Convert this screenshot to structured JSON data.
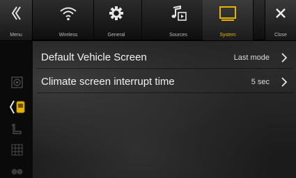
{
  "topbar": {
    "menu_label": "Menu",
    "close_label": "Close",
    "tabs": [
      {
        "label": "Wireless"
      },
      {
        "label": "General"
      },
      {
        "label": "Sources"
      },
      {
        "label": "System"
      }
    ]
  },
  "settings": [
    {
      "label": "Default Vehicle Screen",
      "value": "Last mode"
    },
    {
      "label": "Climate screen interrupt time",
      "value": "5 sec"
    }
  ],
  "colors": {
    "accent": "#e8b300",
    "background": "#1b1b1b",
    "text": "#f2f2f2"
  },
  "icons": {
    "menu": "double-chevron-left-icon",
    "wireless": "wifi-icon",
    "general": "gear-icon",
    "sources": "music-note-icon",
    "system": "monitor-icon",
    "close": "close-icon"
  }
}
